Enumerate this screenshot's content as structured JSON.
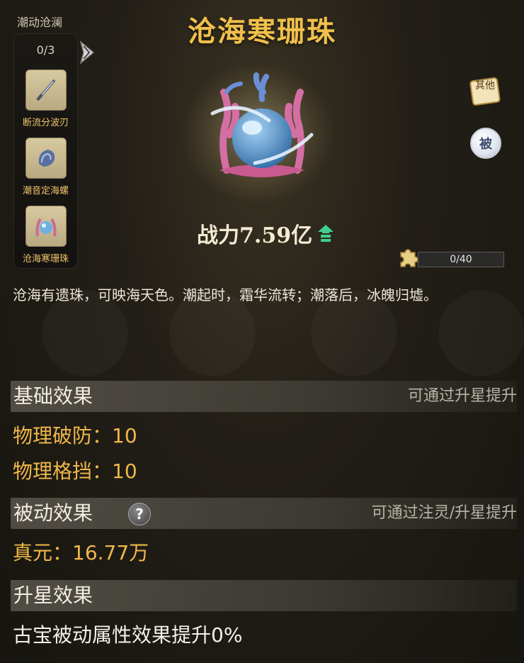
{
  "set": {
    "title": "潮动沧澜",
    "progress": "0/3",
    "items": [
      {
        "label": "断流分波刃",
        "icon": "blade-icon"
      },
      {
        "label": "潮音定海螺",
        "icon": "conch-icon"
      },
      {
        "label": "沧海寒珊珠",
        "icon": "coral-pearl-icon"
      }
    ]
  },
  "item": {
    "title": "沧海寒珊珠",
    "power": "战力7.59亿",
    "fragments": {
      "text": "0/40",
      "fraction": 0
    },
    "description": "沧海有遗珠，可映海天色。潮起时，霜华流转；潮落后，冰魄归墟。"
  },
  "side_buttons": {
    "other": "其他",
    "passive": "被"
  },
  "sections": {
    "basic": {
      "title": "基础效果",
      "hint": "可通过升星提升",
      "stats": [
        "物理破防：10",
        "物理格挡：10"
      ]
    },
    "passive": {
      "title": "被动效果",
      "hint": "可通过注灵/升星提升",
      "help": "?",
      "stats": [
        "真元：16.77万"
      ]
    },
    "star": {
      "title": "升星效果",
      "stats": [
        "古宝被动属性效果提升0%"
      ]
    }
  },
  "colors": {
    "title_gold": "#f0c04a",
    "stat_orange": "#f0b84a",
    "power_arrow_green": "#3fcf8a"
  }
}
